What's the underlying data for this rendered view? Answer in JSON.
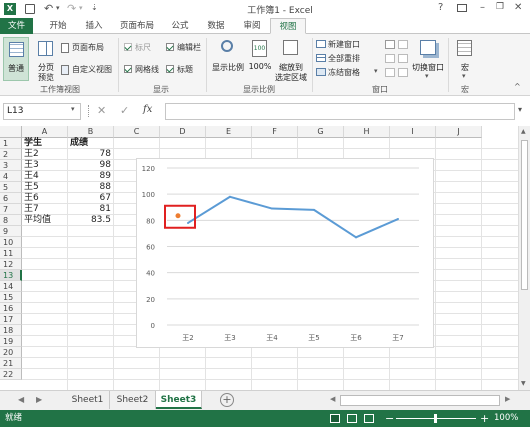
{
  "window": {
    "title": "工作簿1 - Excel",
    "help": "?",
    "minimize": "–",
    "restore": "❐",
    "close": "✕"
  },
  "ribbon_tabs": [
    {
      "label": "文件"
    },
    {
      "label": "开始"
    },
    {
      "label": "插入"
    },
    {
      "label": "页面布局"
    },
    {
      "label": "公式"
    },
    {
      "label": "数据"
    },
    {
      "label": "审阅"
    },
    {
      "label": "视图"
    }
  ],
  "ribbon": {
    "views": {
      "normal": "普通",
      "pagebreak_l1": "分页",
      "pagebreak_l2": "预览",
      "page_layout": "页面布局",
      "custom_view": "自定义视图",
      "group": "工作簿视图"
    },
    "show": {
      "ruler": "标尺",
      "gridlines": "网格线",
      "formula_bar": "编辑栏",
      "headings": "标题",
      "group": "显示"
    },
    "zoom": {
      "zoom": "显示比例",
      "hundred": "100%",
      "to_sel_l1": "缩放到",
      "to_sel_l2": "选定区域",
      "group": "显示比例"
    },
    "window_grp": {
      "new_window": "新建窗口",
      "arrange_all": "全部重排",
      "freeze": "冻结窗格",
      "switch": "切换窗口",
      "group": "窗口"
    },
    "macro": {
      "label": "宏",
      "group": "宏"
    }
  },
  "formula": {
    "namebox": "L13",
    "fx": "fx",
    "cancel": "✕",
    "enter": "✓"
  },
  "columns": [
    "A",
    "B",
    "C",
    "D",
    "E",
    "F",
    "G",
    "H",
    "I",
    "J"
  ],
  "rows": [
    "1",
    "2",
    "3",
    "4",
    "5",
    "6",
    "7",
    "8",
    "9",
    "10",
    "11",
    "12",
    "13",
    "14",
    "15",
    "16",
    "17",
    "18",
    "19",
    "20",
    "21",
    "22"
  ],
  "cells": {
    "A1": "学生",
    "B1": "成绩",
    "A2": "王2",
    "B2": "78",
    "A3": "王3",
    "B3": "98",
    "A4": "王4",
    "B4": "89",
    "A5": "王5",
    "B5": "88",
    "A6": "王6",
    "B6": "67",
    "A7": "王7",
    "B7": "81",
    "A8": "平均值",
    "B8": "83.5"
  },
  "chart_data": {
    "type": "line",
    "categories": [
      "王2",
      "王3",
      "王4",
      "王5",
      "王6",
      "王7"
    ],
    "series": [
      {
        "values": [
          78,
          98,
          89,
          88,
          67,
          81
        ],
        "color": "#5b9bd5"
      }
    ],
    "ylim": [
      0,
      120
    ],
    "yticks": [
      "0",
      "20",
      "40",
      "60",
      "80",
      "100",
      "120"
    ],
    "grid": true,
    "highlight_point": {
      "category": "王2",
      "value": 83.5,
      "color": "#ed7d31"
    },
    "highlight_box_color": "#e02020"
  },
  "sheets": [
    {
      "label": "Sheet1"
    },
    {
      "label": "Sheet2"
    },
    {
      "label": "Sheet3"
    }
  ],
  "sheet_add": "+",
  "status": {
    "ready": "就绪",
    "zoom": "100%",
    "minus": "−",
    "plus": "+"
  }
}
